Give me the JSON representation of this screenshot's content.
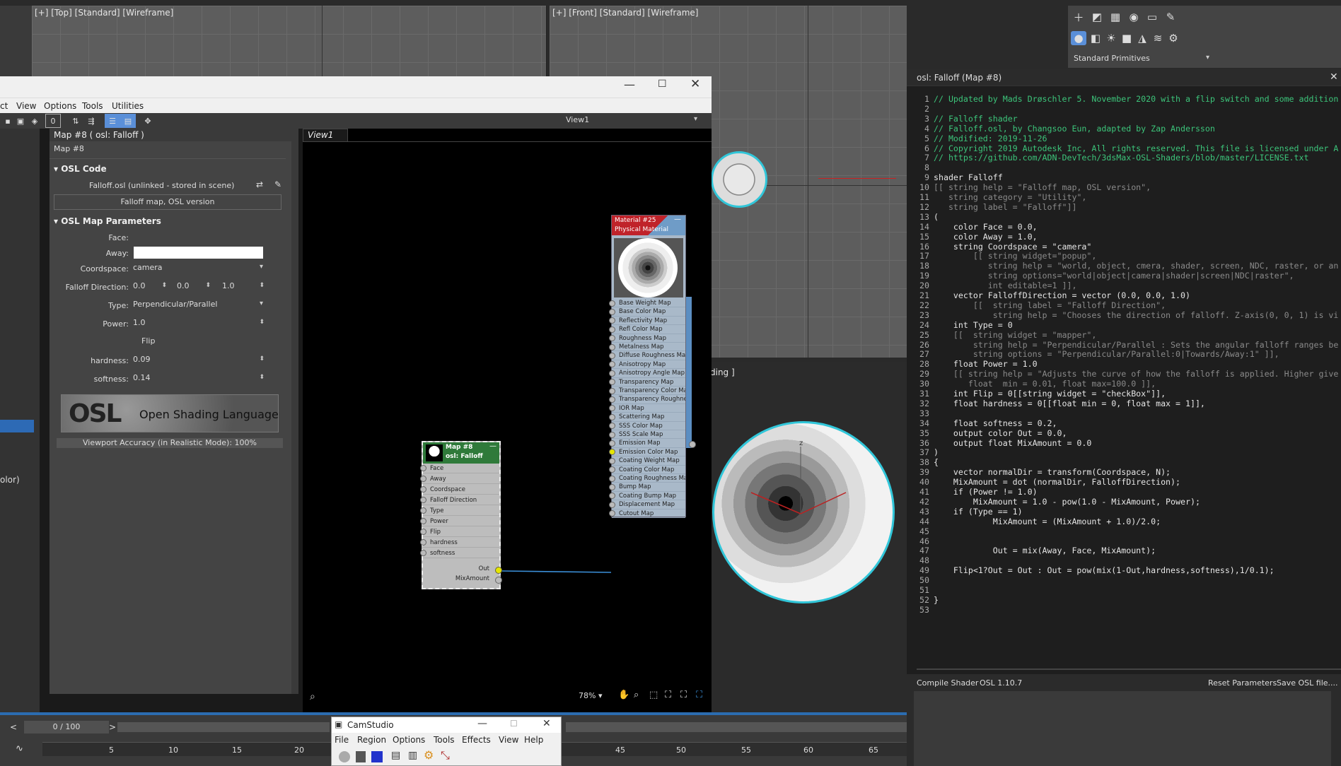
{
  "viewports": {
    "top_label": "[+] [Top] [Standard] [Wireframe]",
    "front_label": "[+] [Front] [Standard] [Wireframe]",
    "shading_partial": "ding ]"
  },
  "command_panel": {
    "dropdown": "Standard Primitives"
  },
  "sme": {
    "menu": [
      "ct",
      "View",
      "Options",
      "Tools",
      "Utilities"
    ],
    "view_tab": "View1",
    "view_select": "View1",
    "zoom": "78%",
    "left_partial": "olor)"
  },
  "params": {
    "header": "Map #8  ( osl: Falloff )",
    "map_name": "Map #8",
    "osl_code_title": "OSL Code",
    "file": "Falloff.osl (unlinked - stored in scene)",
    "desc": "Falloff map, OSL version",
    "map_params_title": "OSL Map Parameters",
    "face_label": "Face:",
    "away_label": "Away:",
    "coordspace_label": "Coordspace:",
    "coordspace_value": "camera",
    "falloff_dir_label": "Falloff Direction:",
    "fd_x": "0.0",
    "fd_y": "0.0",
    "fd_z": "1.0",
    "type_label": "Type:",
    "type_value": "Perpendicular/Parallel",
    "power_label": "Power:",
    "power_value": "1.0",
    "flip_label": "Flip",
    "hardness_label": "hardness:",
    "hardness_value": "0.09",
    "softness_label": "softness:",
    "softness_value": "0.14",
    "osl_logo": "OSL",
    "osl_banner": "Open Shading Language",
    "viewport_accuracy": "Viewport Accuracy (in Realistic Mode): 100%"
  },
  "map_node": {
    "title1": "Map #8",
    "title2": "osl: Falloff",
    "inputs": [
      "Face",
      "Away",
      "Coordspace",
      "Falloff Direction",
      "Type",
      "Power",
      "Flip",
      "hardness",
      "softness"
    ],
    "out": "Out",
    "mixamount": "MixAmount"
  },
  "mat_node": {
    "title1": "Material #25",
    "title2": "Physical Material",
    "slots": [
      "Base Weight Map",
      "Base Color Map",
      "Reflectivity Map",
      "Refl Color Map",
      "Roughness Map",
      "Metalness Map",
      "Diffuse Roughness Map",
      "Anisotropy Map",
      "Anisotropy Angle Map",
      "Transparency Map",
      "Transparency Color Map",
      "Transparency Roughnes...",
      "IOR Map",
      "Scattering Map",
      "SSS Color Map",
      "SSS Scale Map",
      "Emission Map",
      "Emission Color Map",
      "Coating Weight Map",
      "Coating Color Map",
      "Coating Roughness Map",
      "Bump Map",
      "Coating Bump Map",
      "Displacement Map",
      "Cutout Map"
    ]
  },
  "editor": {
    "title": "osl: Falloff (Map #8)",
    "compile": "Compile Shader",
    "version": "OSL 1.10.7",
    "reset": "Reset Parameters",
    "save": "Save OSL file....",
    "lines": [
      "// Updated by Mads Drøschler 5. November 2020 with a flip switch and some addition",
      "",
      "// Falloff shader",
      "// Falloff.osl, by Changsoo Eun, adapted by Zap Andersson",
      "// Modified: 2019-11-26",
      "// Copyright 2019 Autodesk Inc, All rights reserved. This file is licensed under A",
      "// https://github.com/ADN-DevTech/3dsMax-OSL-Shaders/blob/master/LICENSE.txt",
      "",
      "shader Falloff",
      "[[ string help = \"Falloff map, OSL version\",",
      "   string category = \"Utility\",",
      "   string label = \"Falloff\"]]",
      "(",
      "    color Face = 0.0,",
      "    color Away = 1.0,",
      "    string Coordspace = \"camera\"",
      "        [[ string widget=\"popup\",",
      "           string help = \"world, object, cmera, shader, screen, NDC, raster, or an",
      "           string options=\"world|object|camera|shader|screen|NDC|raster\",",
      "           int editable=1 ]],",
      "    vector FalloffDirection = vector (0.0, 0.0, 1.0)",
      "        [[  string label = \"Falloff Direction\",",
      "            string help = \"Chooses the direction of falloff. Z-axis(0, 0, 1) is vi",
      "    int Type = 0",
      "    [[  string widget = \"mapper\",",
      "        string help = \"Perpendicular/Parallel : Sets the angular falloff ranges be",
      "        string options = \"Perpendicular/Parallel:0|Towards/Away:1\" ]],",
      "    float Power = 1.0",
      "    [[ string help = \"Adjusts the curve of how the falloff is applied. Higher give",
      "       float  min = 0.01, float max=100.0 ]],",
      "    int Flip = 0[[string widget = \"checkBox\"]],",
      "    float hardness = 0[[float min = 0, float max = 1]],",
      "",
      "    float softness = 0.2,",
      "    output color Out = 0.0,",
      "    output float MixAmount = 0.0",
      ")",
      "{",
      "    vector normalDir = transform(Coordspace, N);",
      "    MixAmount = dot (normalDir, FalloffDirection);",
      "    if (Power != 1.0)",
      "        MixAmount = 1.0 - pow(1.0 - MixAmount, Power);",
      "    if (Type == 1)",
      "            MixAmount = (MixAmount + 1.0)/2.0;",
      "",
      "",
      "            Out = mix(Away, Face, MixAmount);",
      "",
      "    Flip<1?Out = Out : Out = pow(mix(1-Out,hardness,softness),1/0.1);",
      "",
      "",
      "}",
      ""
    ]
  },
  "timeline": {
    "frame": "0 / 100",
    "ticks": [
      "5",
      "10",
      "15",
      "20",
      "45",
      "50",
      "55",
      "60",
      "65"
    ]
  },
  "camstudio": {
    "title": "CamStudio",
    "menu": [
      "File",
      "Region",
      "Options",
      "Tools",
      "Effects",
      "View",
      "Help"
    ]
  },
  "colors": {
    "accent": "#31c6d9",
    "node_green": "#2f7a3a",
    "node_red": "#c0232a",
    "mat_blue": "#6f9cc7"
  }
}
